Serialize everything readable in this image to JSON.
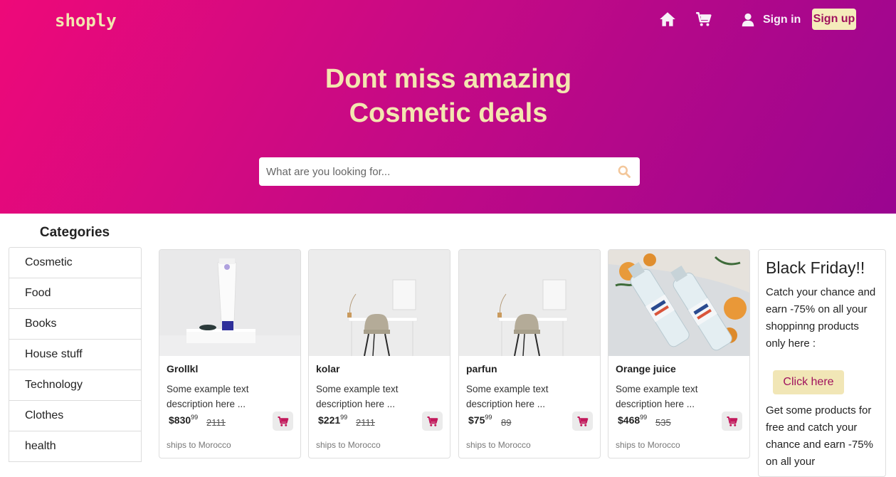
{
  "brand": "shoply",
  "nav": {
    "home_icon": "home-icon",
    "cart_icon": "cart-icon",
    "user_icon": "user-icon",
    "signin_label": "Sign in",
    "signup_label": "Sign up"
  },
  "hero": {
    "line1": "Dont miss amazing",
    "line2": "Cosmetic deals"
  },
  "search": {
    "placeholder": "What are you looking for...",
    "icon": "search-icon"
  },
  "categories": {
    "title": "Categories",
    "items": [
      "Cosmetic",
      "Food",
      "Books",
      "House stuff",
      "Technology",
      "Clothes",
      "health"
    ]
  },
  "products": [
    {
      "name": "Grollkl",
      "desc": "Some example text description here ...",
      "price": "$830",
      "cents": "99",
      "old_price": "2111",
      "ships": "ships to Morocco",
      "image": "cosmetic-tube-image"
    },
    {
      "name": "kolar",
      "desc": "Some example text description here ...",
      "price": "$221",
      "cents": "99",
      "old_price": "2111",
      "ships": "ships to Morocco",
      "image": "desk-chair-image"
    },
    {
      "name": "parfun",
      "desc": "Some example text description here ...",
      "price": "$75",
      "cents": "99",
      "old_price": "89",
      "ships": "ships to Morocco",
      "image": "desk-chair-image"
    },
    {
      "name": "Orange juice",
      "desc": "Some example text description here ...",
      "price": "$468",
      "cents": "99",
      "old_price": "535",
      "ships": "ships to Morocco",
      "image": "water-bottles-image"
    }
  ],
  "promo": {
    "title": "Black Friday!!",
    "text1": "Catch your chance and earn -75% on all your shoppinng products only here :",
    "button": "Click here",
    "text2": "Get some products for free and catch your chance and earn -75% on all your"
  },
  "colors": {
    "gradient_start": "#ee0979",
    "gradient_end": "#9a0590",
    "accent": "#f3e6b0",
    "cart_pink": "#c2185b"
  }
}
